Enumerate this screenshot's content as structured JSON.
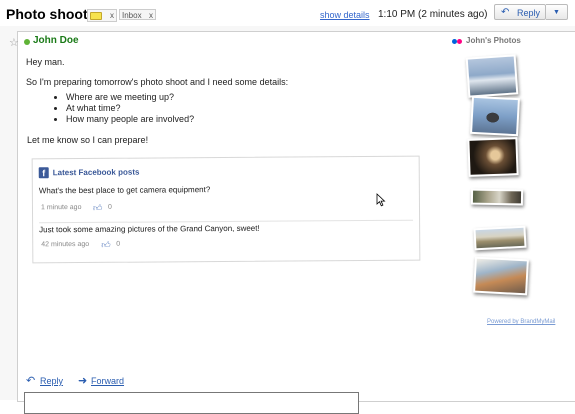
{
  "header": {
    "subject": "Photo shoot",
    "label_close": "x",
    "inbox_label": "Inbox",
    "inbox_close": "x",
    "show_details": "show details",
    "timestamp": "1:10 PM (2 minutes ago)",
    "reply_button": "Reply",
    "more_button": "▼"
  },
  "message": {
    "sender": "John Doe",
    "greeting": "Hey man.",
    "intro": "So I'm preparing tomorrow's photo shoot and I need some details:",
    "bullets": [
      "Where are we meeting up?",
      "At what time?",
      "How many people are involved?"
    ],
    "closing": "Let me know so I can prepare!"
  },
  "facebook": {
    "title": "Latest Facebook posts",
    "icon_letter": "f",
    "posts": [
      {
        "text": "What's the best place to get camera equipment?",
        "time": "1 minute ago",
        "likes": "0"
      },
      {
        "text": "Just took some amazing pictures of the Grand Canyon, sweet!",
        "time": "42 minutes ago",
        "likes": "0"
      }
    ]
  },
  "photos": {
    "title": "John's Photos",
    "powered_by": "Powered by BrandMyMail"
  },
  "footer": {
    "reply": "Reply",
    "forward": "Forward"
  },
  "colors": {
    "link": "#2a5db0",
    "sender": "#1a7a17",
    "facebook": "#3b5998",
    "online": "#5fb336"
  }
}
